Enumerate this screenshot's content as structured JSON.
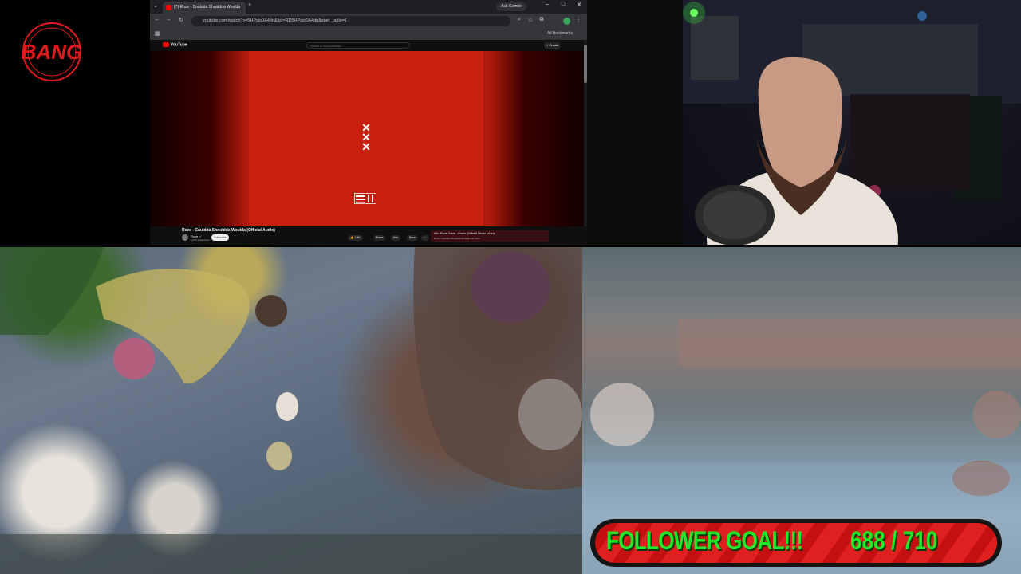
{
  "logo": {
    "text": "BANG"
  },
  "browser": {
    "tab_title": "(7) Roze - Couldda Shouldda Woulda",
    "gemini_label": "Ask Gemini",
    "url": "youtube.com/watch?v=5HPsio0A4do&list=RD5HPsio0A4do&start_radio=1",
    "bookmarks_label": "All Bookmarks",
    "window_controls": [
      "–",
      "□",
      "✕"
    ]
  },
  "youtube": {
    "logo_text": "YouTube",
    "search_placeholder": "Search or find a channel",
    "create_label": "+ Create",
    "video_title": "Roze - Couldda Shouldda Woulda (Official Audio)",
    "channel_name": "Roze ✓",
    "channel_subs": "6.47K subscribers",
    "subscribe_label": "Subscribe",
    "actions": [
      "👍 1.4K",
      "Share",
      "Ask",
      "Save",
      "⋯"
    ],
    "mix_title": "Mix: Roze Gave - Poem (Official Music Video)",
    "mix_sub": "Roze, Couldda Shouldda Woulda and more"
  },
  "goal": {
    "label": "FOLLOWER GOAL!!!",
    "current": 688,
    "target": 710,
    "count_text": "688 / 710"
  },
  "colors": {
    "goal_text": "#22e82a",
    "goal_stripe": "#e0201e",
    "logo_red": "#e01a1a",
    "album_red": "#c8200f"
  }
}
